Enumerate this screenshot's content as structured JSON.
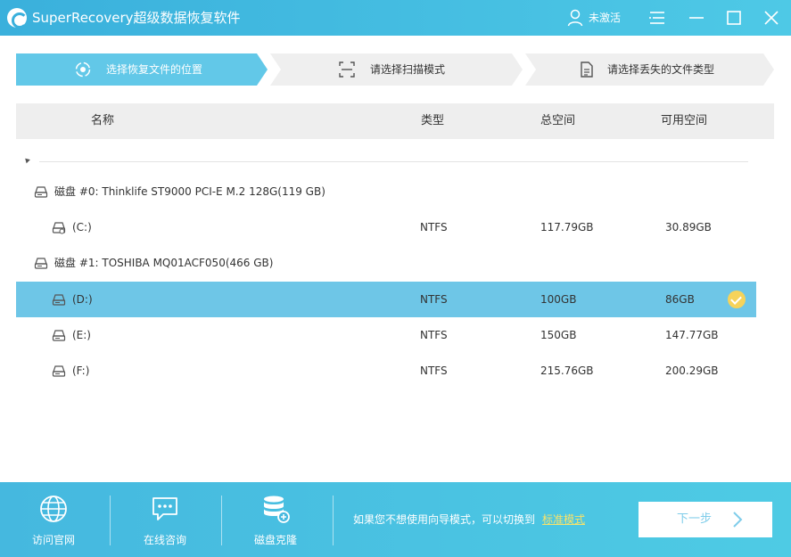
{
  "titlebar": {
    "app_title": "SuperRecovery超级数据恢复软件",
    "user_status": "未激活"
  },
  "steps": [
    {
      "label": "选择恢复文件的位置",
      "active": true,
      "icon": "target-icon"
    },
    {
      "label": "请选择扫描模式",
      "active": false,
      "icon": "scan-icon"
    },
    {
      "label": "请选择丢失的文件类型",
      "active": false,
      "icon": "document-icon"
    }
  ],
  "table": {
    "headers": {
      "name": "名称",
      "type": "类型",
      "total": "总空间",
      "free": "可用空间"
    },
    "disks": [
      {
        "name": "磁盘 #0: Thinklife ST9000 PCI-E M.2 128G(119 GB)",
        "partitions": [
          {
            "name": "(C:)",
            "type": "NTFS",
            "total": "117.79GB",
            "free": "30.89GB",
            "selected": false,
            "system": true
          }
        ]
      },
      {
        "name": "磁盘 #1: TOSHIBA MQ01ACF050(466 GB)",
        "partitions": [
          {
            "name": "(D:)",
            "type": "NTFS",
            "total": "100GB",
            "free": "86GB",
            "selected": true,
            "system": false
          },
          {
            "name": "(E:)",
            "type": "NTFS",
            "total": "150GB",
            "free": "147.77GB",
            "selected": false,
            "system": false
          },
          {
            "name": "(F:)",
            "type": "NTFS",
            "total": "215.76GB",
            "free": "200.29GB",
            "selected": false,
            "system": false
          }
        ]
      }
    ]
  },
  "bottom": {
    "items": [
      {
        "label": "访问官网",
        "icon": "globe-icon"
      },
      {
        "label": "在线咨询",
        "icon": "chat-icon"
      },
      {
        "label": "磁盘克隆",
        "icon": "database-clone-icon"
      }
    ],
    "hint": "如果您不想使用向导模式，可以切换到",
    "mode_link": "标准模式",
    "next_label": "下一步"
  },
  "colors": {
    "accent": "#4ec9e6",
    "selected_row": "#6ec6e7",
    "check": "#f6d35a",
    "link": "#f8e36a"
  }
}
